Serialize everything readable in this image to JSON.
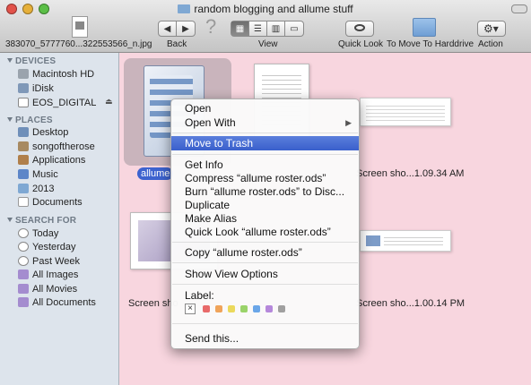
{
  "window": {
    "title": "random blogging and allume stuff"
  },
  "toolbar": {
    "file_label": "383070_5777760...322553566_n.jpg",
    "back_label": "Back",
    "view_label": "View",
    "quicklook_label": "Quick Look",
    "move_label": "To Move To Harddrive",
    "action_label": "Action"
  },
  "sidebar": {
    "sections": [
      {
        "title": "DEVICES",
        "items": [
          "Macintosh HD",
          "iDisk",
          "EOS_DIGITAL"
        ]
      },
      {
        "title": "PLACES",
        "items": [
          "Desktop",
          "songoftherose",
          "Applications",
          "Music",
          "2013",
          "Documents"
        ]
      },
      {
        "title": "SEARCH FOR",
        "items": [
          "Today",
          "Yesterday",
          "Past Week",
          "All Images",
          "All Movies",
          "All Documents"
        ]
      }
    ]
  },
  "content": {
    "selected_file_label": "allume",
    "caption_1": "Screen sho...1.09.34 AM",
    "caption_2": "Screen sho",
    "caption_3": "Screen sho...1.00.14 PM"
  },
  "context_menu": {
    "items": [
      "Open",
      "Open With",
      "Move to Trash",
      "Get Info",
      "Compress “allume roster.ods”",
      "Burn “allume roster.ods” to Disc...",
      "Duplicate",
      "Make Alias",
      "Quick Look “allume roster.ods”",
      "Copy “allume roster.ods”",
      "Show View Options",
      "Label:",
      "Send this..."
    ],
    "label_clear": "×"
  },
  "colors": {
    "content_bg": "#f8d6df",
    "highlight": "#3d63cf",
    "label_colors": [
      "#e86a6a",
      "#f0a45a",
      "#ebd95c",
      "#9ad36a",
      "#6aa6e8",
      "#b588db",
      "#a0a0a0"
    ]
  }
}
